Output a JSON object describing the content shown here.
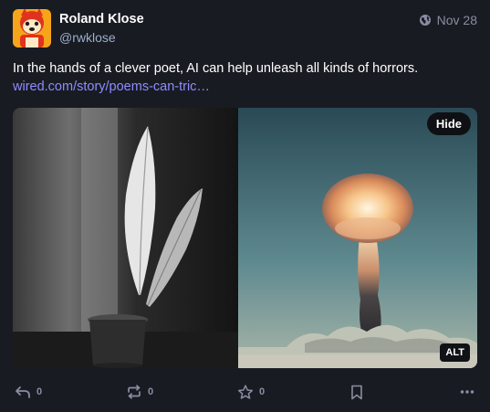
{
  "post": {
    "author": {
      "display_name": "Roland Klose",
      "handle": "@rwklose",
      "avatar": "cartoon-fox-avatar"
    },
    "visibility_icon": "globe-icon",
    "timestamp": "Nov 28",
    "text": "In the hands of a clever poet, AI can help unleash all kinds of horrors.",
    "link": "wired.com/story/poems-can-tric…",
    "media": {
      "hide_label": "Hide",
      "alt_label": "ALT",
      "images": [
        "quill-feathers-in-inkwell-photo",
        "mushroom-cloud-explosion-photo"
      ]
    },
    "actions": {
      "reply": {
        "icon": "reply-icon",
        "count": "0"
      },
      "boost": {
        "icon": "boost-icon",
        "count": "0"
      },
      "favourite": {
        "icon": "star-icon",
        "count": "0"
      },
      "bookmark": {
        "icon": "bookmark-icon"
      },
      "more": {
        "icon": "more-icon"
      }
    }
  },
  "colors": {
    "background": "#191b22",
    "link": "#8c8dff",
    "muted": "#8a8da1",
    "handle": "#9baec8"
  }
}
